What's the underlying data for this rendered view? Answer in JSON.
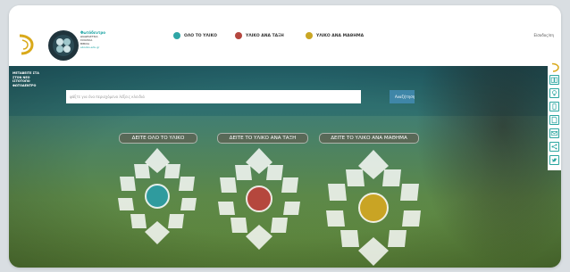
{
  "header": {
    "brand": {
      "title": "Φωτόδεντρο",
      "sub1": "ΔΙΑΔΡΑΣΤΙΚΑ",
      "sub2": "ΣΧΟΛΙΚΑ",
      "sub3": "ΒΙΒΛΙΑ",
      "sub4": "ebooks.edu.gr"
    },
    "nav": [
      {
        "label": "ΟΛΟ ΤΟ ΥΛΙΚΟ",
        "color": "#2fa6a6"
      },
      {
        "label": "ΥΛΙΚΟ ΑΝΑ ΤΑΞΗ",
        "color": "#b4473f"
      },
      {
        "label": "ΥΛΙΚΟ ΑΝΑ ΜΑΘΗΜΑ",
        "color": "#c9a624"
      }
    ],
    "login": "Είσοδος/ση"
  },
  "hero": {
    "side_links": [
      "ΜΕΤΑΒΕΙΤΕ ΣΤΑ",
      "ΣΤΟΝ ΝΕΟ",
      "ΙΣΤΟΤΟΠΟ",
      "ΦΩΤΟΔΕΝΤΡΟ"
    ],
    "search_placeholder": "ψάξτε για ένα περιεχόμενο λέξεις κλειδιά",
    "search_button": "Αναζήτηση",
    "categories": [
      {
        "label": "ΔΕΙΤΕ ΟΛΟ ΤΟ ΥΛΙΚΟ",
        "center": "#2f9b9e"
      },
      {
        "label": "ΔΕΙΤΕ ΤΟ ΥΛΙΚΟ ΑΝΑ ΤΑΞΗ",
        "center": "#b5473d"
      },
      {
        "label": "ΔΕΙΤΕ ΤΟ ΥΛΙΚΟ ΑΝΑ ΜΑΘΗΜΑ",
        "center": "#c9a424"
      }
    ]
  },
  "right_bar": [
    "logo-icon",
    "book-icon",
    "lightbulb-icon",
    "mobile-icon",
    "file-icon",
    "mail-icon",
    "share-icon",
    "twitter-icon"
  ]
}
